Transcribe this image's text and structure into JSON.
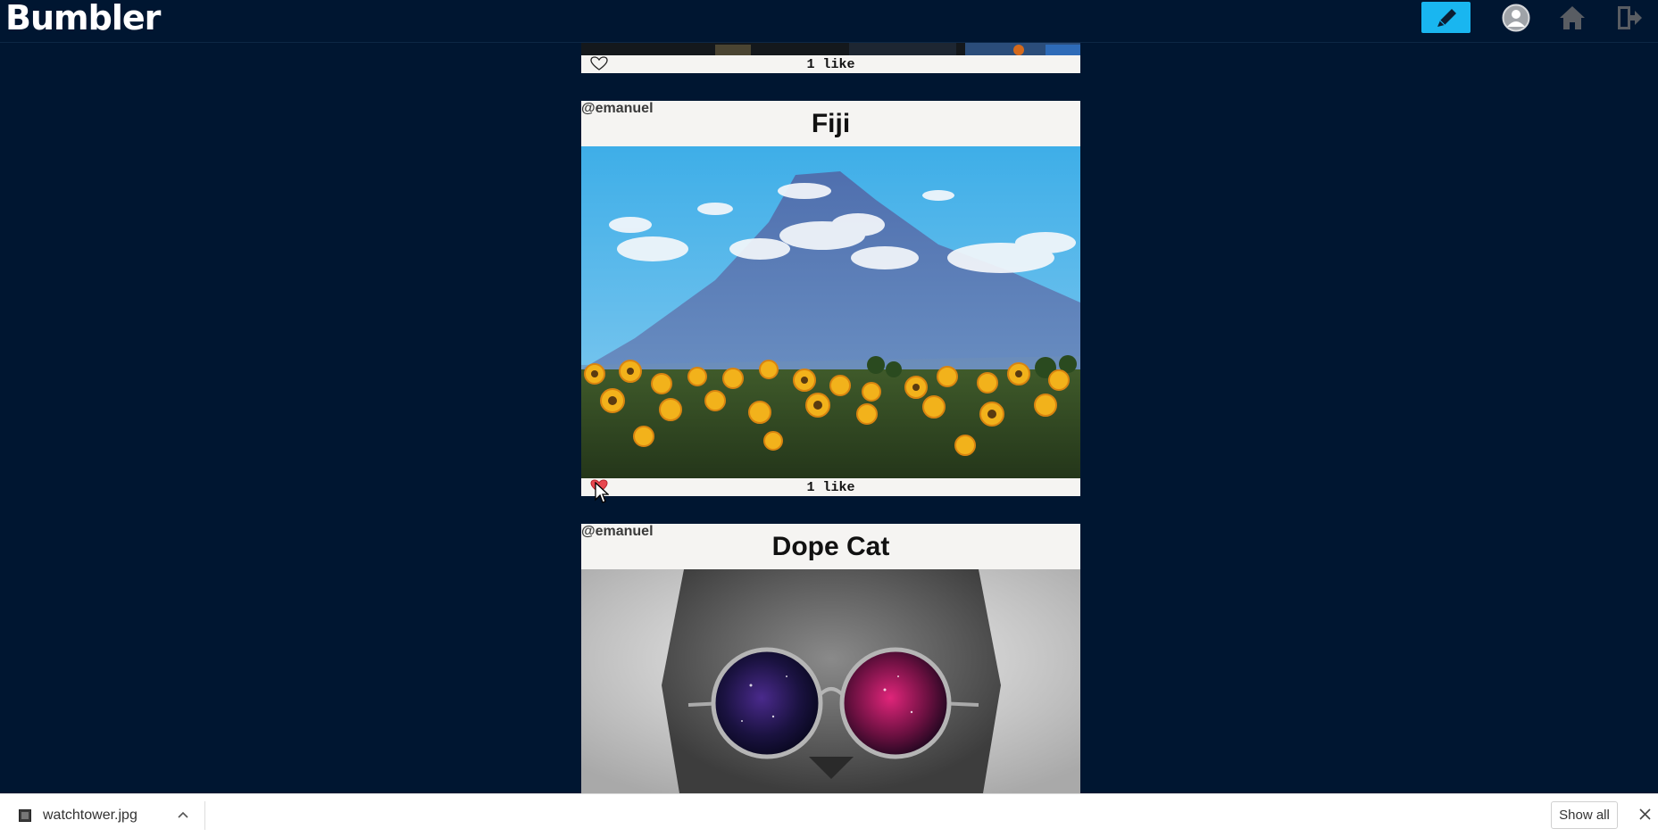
{
  "app": {
    "name": "Bumbler"
  },
  "header": {
    "new_post_icon": "pencil-icon",
    "profile_icon": "user-avatar-icon",
    "home_icon": "home-icon",
    "logout_icon": "logout-icon",
    "accent_color": "#19b6f0"
  },
  "posts": [
    {
      "author": "",
      "title": "",
      "likes_label": "1 like",
      "liked": false
    },
    {
      "author": "@emanuel",
      "title": "Fiji",
      "image": "mountain with sunflower field",
      "likes_label": "1 like",
      "liked": true
    },
    {
      "author": "@emanuel",
      "title": "Dope Cat",
      "image": "cat wearing galaxy sunglasses",
      "likes_label": "",
      "liked": false
    }
  ],
  "download_bar": {
    "filename": "watchtower.jpg",
    "show_all_label": "Show all"
  },
  "colors": {
    "background": "#001631",
    "card": "#f5f4f2",
    "heart_liked": "#e8474f"
  }
}
